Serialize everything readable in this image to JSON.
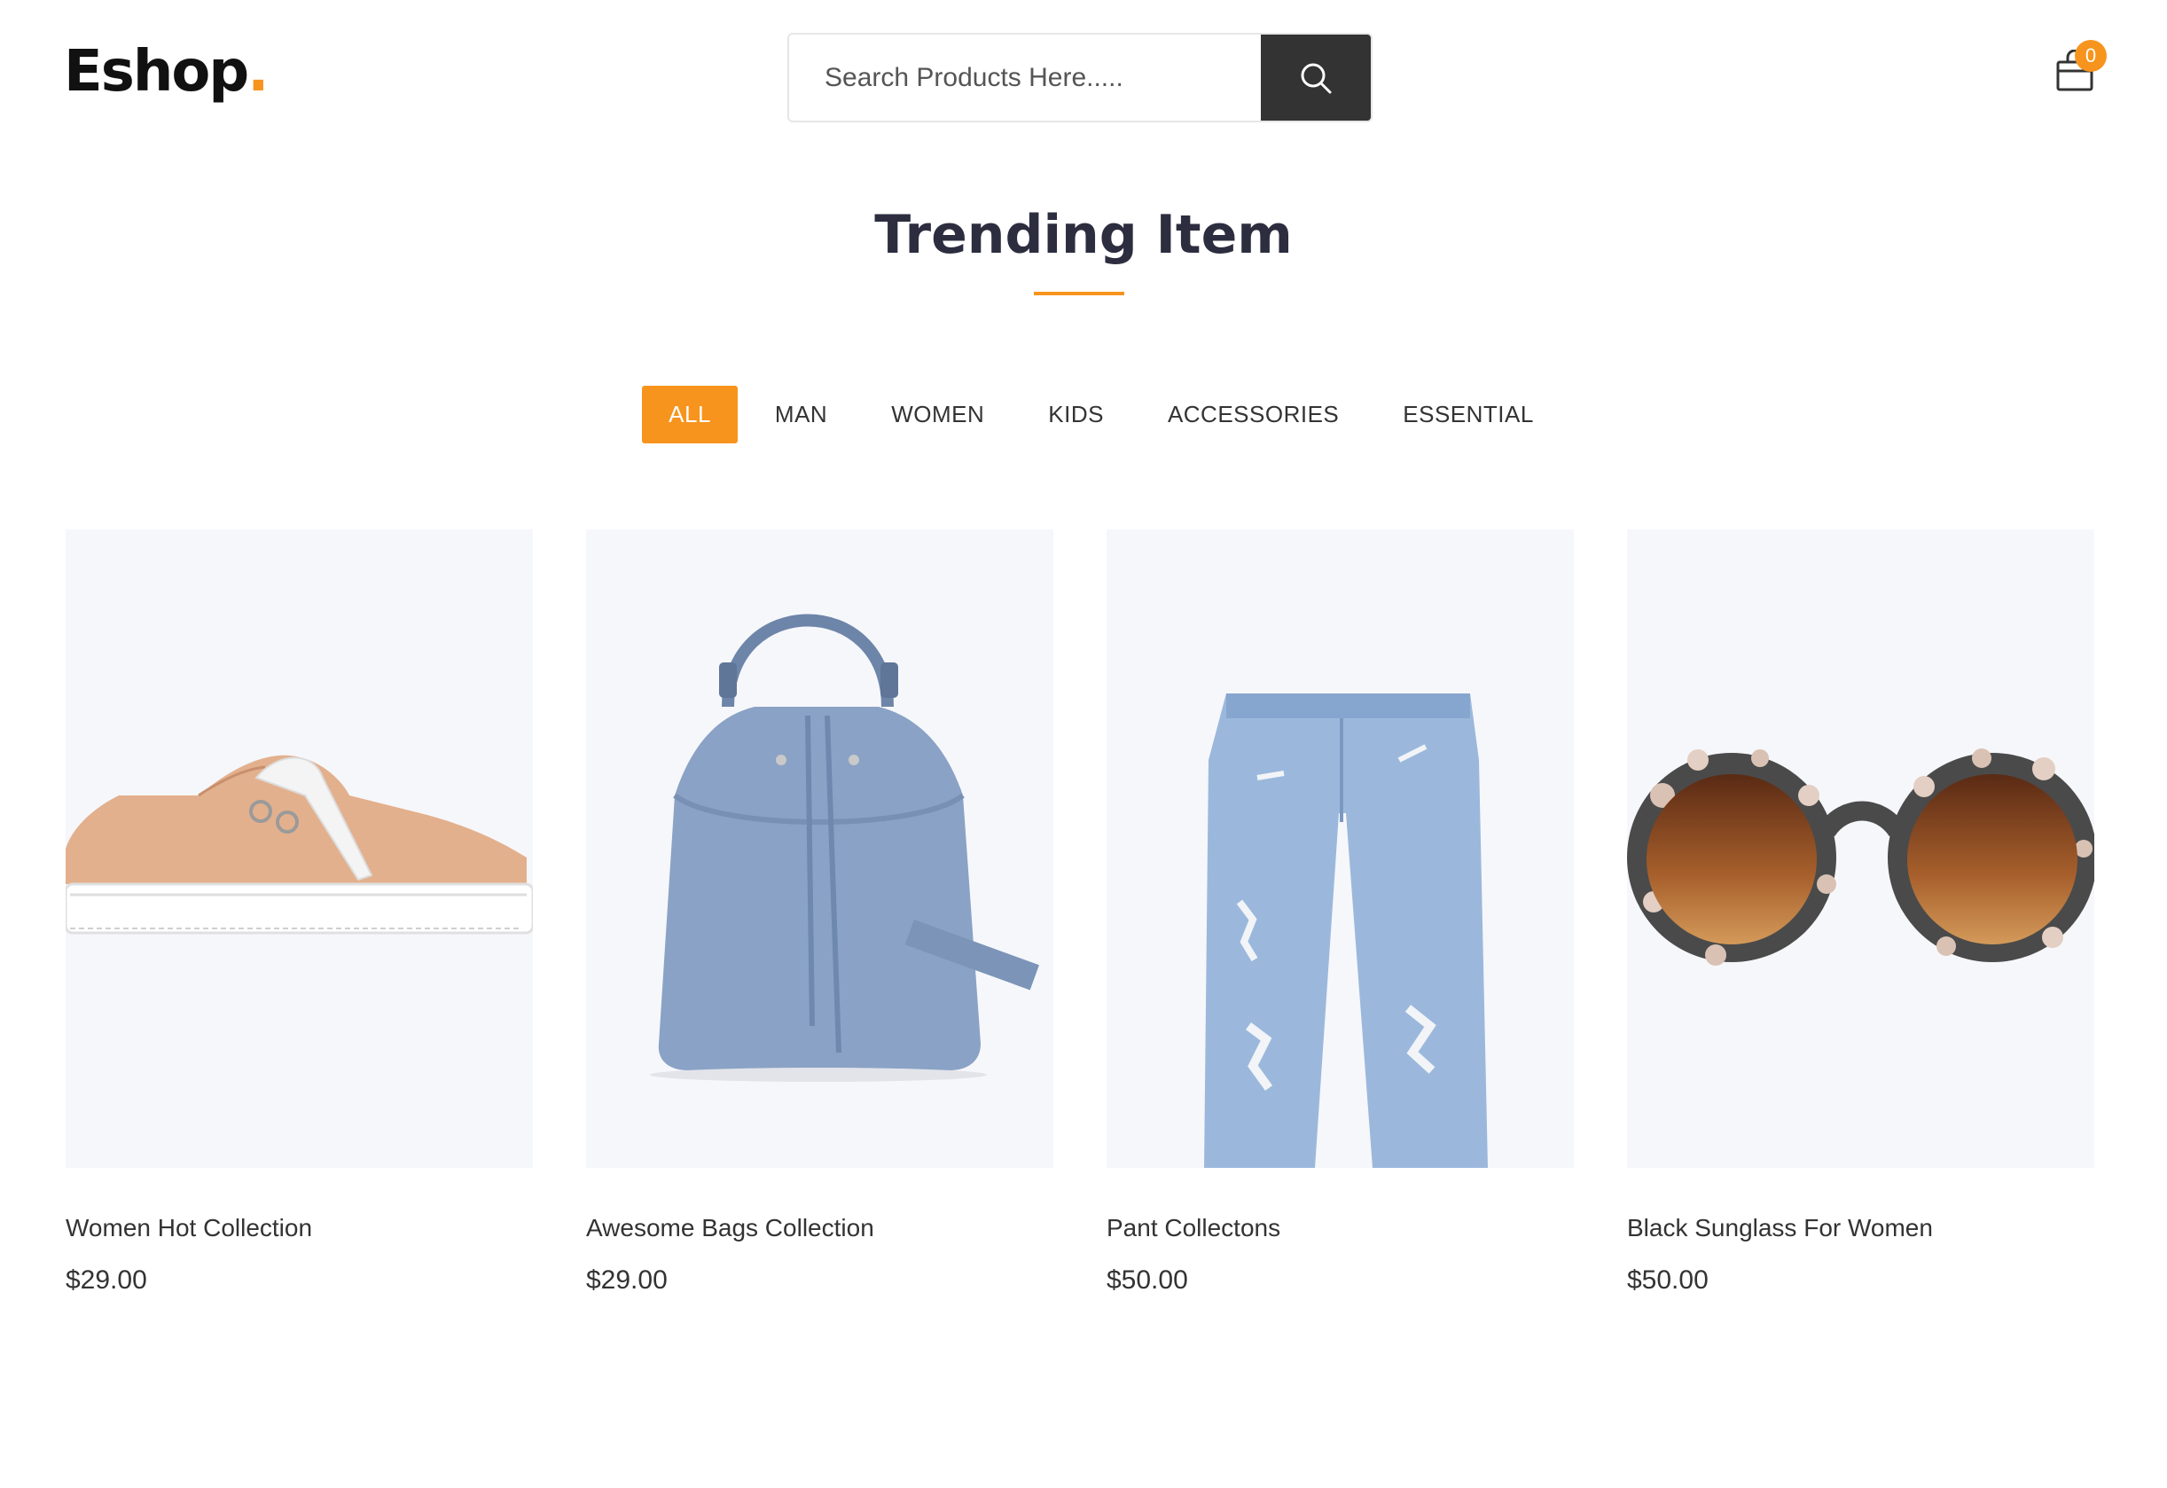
{
  "header": {
    "logo_text": "Eshop",
    "logo_dot": ".",
    "search_placeholder": "Search Products Here.....",
    "cart_count": "0"
  },
  "section": {
    "title": "Trending Item"
  },
  "filters": [
    "ALL",
    "MAN",
    "WOMEN",
    "KIDS",
    "ACCESSORIES",
    "ESSENTIAL"
  ],
  "active_filter": "ALL",
  "products": [
    {
      "title": "Women Hot Collection",
      "price": "$29.00",
      "image": "sneaker"
    },
    {
      "title": "Awesome Bags Collection",
      "price": "$29.00",
      "image": "bucket-bag"
    },
    {
      "title": "Pant Collectons",
      "price": "$50.00",
      "image": "jeans"
    },
    {
      "title": "Black Sunglass For Women",
      "price": "$50.00",
      "image": "sunglasses"
    }
  ],
  "colors": {
    "accent": "#F7941D",
    "dark": "#333333",
    "card_bg": "#f6f7fb"
  }
}
